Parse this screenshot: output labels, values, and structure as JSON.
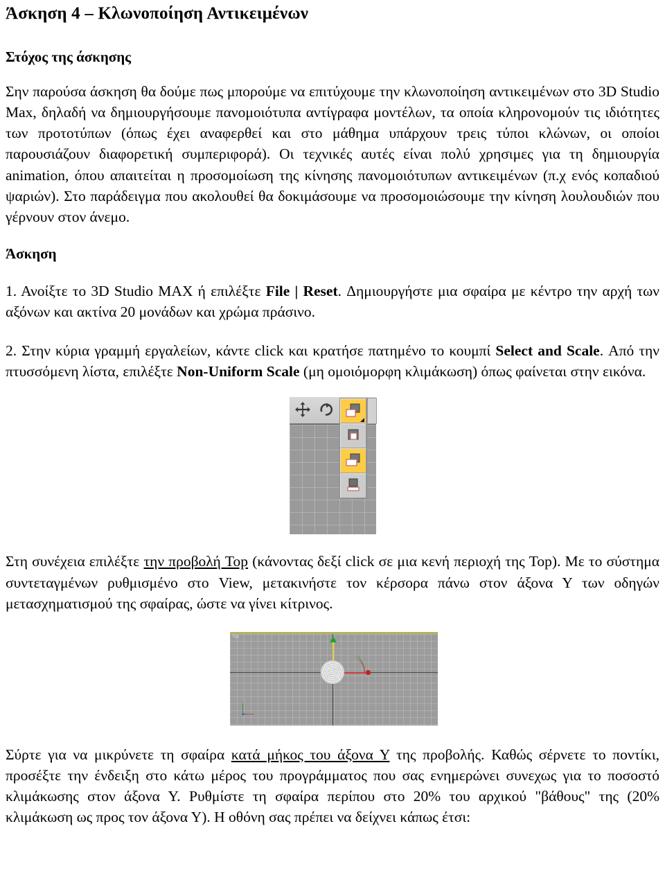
{
  "document": {
    "title": "Άσκηση 4 – Κλωνοποίηση Αντικειμένων",
    "section_goal_heading": "Στόχος της άσκησης",
    "intro_paragraph": "Σην παρούσα άσκηση θα δούμε πως μπορούμε να επιτύχουμε την κλωνοποίηση αντικειμένων στο 3D Studio Max, δηλαδή να δημιουργήσουμε πανομοιότυπα αντίγραφα μοντέλων, τα οποία κληρονομούν τις ιδιότητες των προτοτύπων (όπως έχει αναφερθεί και στο μάθημα υπάρχουν τρεις τύποι κλώνων, οι οποίοι παρουσιάζουν διαφορετική συμπεριφορά). Οι τεχνικές αυτές είναι πολύ χρησιμες για τη δημιουργία animation, όπου απαιτείται η προσομοίωση της κίνησης πανομοιότυπων αντικειμένων (π.χ ενός κοπαδιού ψαριών). Στο παράδειγμα που ακολουθεί θα δοκιμάσουμε να προσομοιώσουμε την κίνηση λουλουδιών που γέρνουν στον άνεμο.",
    "section_exercise_heading": "Άσκηση",
    "steps": [
      {
        "number": "1.",
        "part1": " Ανοίξτε το 3D Studio MAX ή επιλέξτε ",
        "bold1": "File | Reset",
        "part2": ". Δημιουργήστε μια σφαίρα με κέντρο την αρχή των αξόνων και ακτίνα 20 μονάδων και χρώμα πράσινο."
      },
      {
        "number": "2.",
        "part1": " Στην κύρια γραμμή εργαλείων, κάντε click και κρατήσε πατημένο το κουμπί ",
        "bold1": "Select and Scale",
        "part2": ". Από την πτυσσόμενη λίστα, επιλέξτε ",
        "bold2": "Non-Uniform Scale",
        "part3": " (μη ομοιόμορφη κλιμάκωση) όπως φαίνεται στην εικόνα."
      }
    ],
    "paragraph_top_view": {
      "part1": "Στη συνέχεια επιλέξτε ",
      "underlined": "την προβολή Top",
      "part2": " (κάνοντας δεξί click σε μια κενή περιοχή της Top). Με το σύστημα συντεταγμένων ρυθμισμένο στο View, μετακινήστε τον κέρσορα πάνω στον άξονα Υ των οδηγών μετασχηματισμού της σφαίρας, ώστε να γίνει κίτρινος."
    },
    "paragraph_scale": {
      "part1": "Σύρτε για να μικρύνετε τη σφαίρα ",
      "underlined": "κατά μήκος του άξονα Υ",
      "part2": " της προβολής. Καθώς σέρνετε το ποντίκι, προσέξτε την ένδειξη στο κάτω μέρος του προγράμματος που σας ενημερώνει συνεχως για το ποσοστό κλιμάκωσης στον άξονα Υ. Ρυθμίστε τη σφαίρα περίπου στο 20% του αρχικού \"βάθους\" της (20% κλιμάκωση ως προς τον άξονα Υ). Η οθόνη σας πρέπει να δείχνει κάπως έτσι:"
    }
  },
  "figure_toolbar": {
    "caption": "",
    "icons": [
      {
        "name": "select-and-move-icon",
        "label": "Select and Move"
      },
      {
        "name": "select-and-rotate-icon",
        "label": "Select and Rotate"
      }
    ],
    "flyout_items": [
      {
        "name": "select-and-uniform-scale-icon",
        "label": "Select and Uniform Scale",
        "selected": true
      },
      {
        "name": "select-and-squash-icon",
        "label": "Select and Squash",
        "selected": false
      },
      {
        "name": "select-and-non-uniform-scale-icon",
        "label": "Non-Uniform Scale",
        "selected": true
      },
      {
        "name": "select-and-squash-alt-icon",
        "label": "Select and Squash",
        "selected": false
      }
    ],
    "highlight_color": "#ffcc44",
    "toolbar_color": "#cccccc"
  },
  "figure_viewport": {
    "viewport_label": "Top",
    "axes": {
      "y_axis_color": "#e3d23a",
      "x_axis_color": "#d23a3a",
      "y_handle_color": "#22a035"
    },
    "background_color": "#9c9c9c",
    "active_border_color": "#b5b060"
  }
}
